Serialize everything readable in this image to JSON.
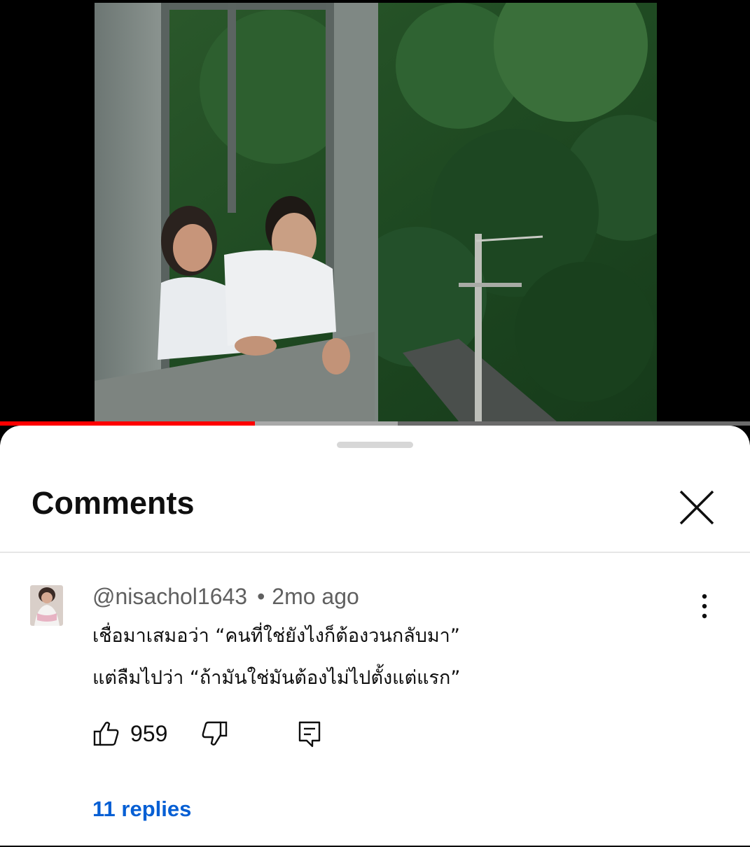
{
  "video": {
    "progress_played": 0.34,
    "progress_buffered": 0.53,
    "colors": {
      "played": "#ff0000",
      "buffered": "#a9a9a9",
      "track": "#6b6b6b"
    }
  },
  "sheet": {
    "title": "Comments",
    "close_icon": "close-icon"
  },
  "comment": {
    "author": "@nisachol1643",
    "separator": "•",
    "time": "2mo ago",
    "text_line1": "เชื่อมาเสมอว่า “คนที่ใช่ยังไงก็ต้องวนกลับมา”",
    "text_line2": "แต่ลืมไปว่า “ถ้ามันใช่มันต้องไม่ไปตั้งแต่แรก”",
    "likes": "959",
    "replies_label": "11 replies",
    "icons": {
      "like": "thumbs-up-icon",
      "dislike": "thumbs-down-icon",
      "reply": "reply-comment-icon",
      "more": "more-vertical-icon"
    },
    "link_color": "#065fd4"
  }
}
